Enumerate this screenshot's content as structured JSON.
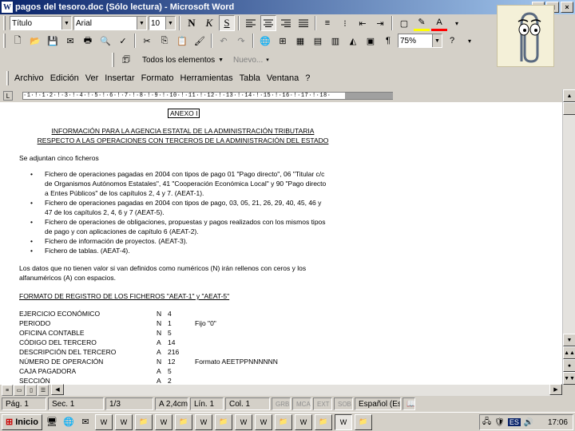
{
  "window": {
    "title": "pagos del tesoro.doc (Sólo lectura) - Microsoft Word",
    "app_icon": "word-doc-icon"
  },
  "format_toolbar": {
    "style": "Título",
    "font": "Arial",
    "size": "10",
    "zoom": "75%"
  },
  "reviewing_toolbar": {
    "show": "Todos los elementos",
    "new_comment": "Nuevo..."
  },
  "menu": {
    "items": [
      "Archivo",
      "Edición",
      "Ver",
      "Insertar",
      "Formato",
      "Herramientas",
      "Tabla",
      "Ventana",
      "?"
    ]
  },
  "ruler": {
    "text": "·1·!·1·2·!·3·!·4·!·5·!·6·!·7·!·8·!·9·!·10·!·11·!·12·!·13·!·14·!·15·!·16·!·17·!·18·"
  },
  "document": {
    "anexo": "ANEXO I",
    "heading1": "INFORMACIÓN PARA LA AGENCIA ESTATAL DE LA ADMINISTRACIÓN TRIBUTARIA",
    "heading2": "RESPECTO A LAS OPERACIONES CON TERCEROS DE LA ADMINISTRACIÓN DEL ESTADO",
    "intro": "Se adjuntan cinco ficheros",
    "bullets": [
      [
        "Fichero de operaciones pagadas en 2004 con tipos de pago 01 \"Pago directo\", 06 \"Titular c/c",
        "de Organismos Autónomos Estatales\", 41 \"Cooperación Económica Local\" y 90 \"Pago directo",
        "a Entes Públicos\" de los capítulos 2, 4 y 7. (AEAT-1)."
      ],
      [
        "Fichero de operaciones pagadas en 2004 con tipos de pago, 03, 05, 21, 26, 29, 40, 45, 46 y",
        "47 de los capítulos 2, 4, 6 y 7 (AEAT-5)."
      ],
      [
        "Fichero de operaciones de obligaciones, propuestas y pagos realizados con los mismos tipos",
        "de pago y con aplicaciones de capítulo 6 (AEAT-2)."
      ],
      [
        "Fichero de información de proyectos. (AEAT-3)."
      ],
      [
        "Fichero de tablas. (AEAT-4)."
      ]
    ],
    "para2": [
      "Los datos que no tienen valor si van definidos como numéricos (N) irán rellenos con ceros y los",
      "alfanuméricos (A) con espacios."
    ],
    "format_title": "FORMATO DE REGISTRO DE LOS FICHEROS \"AEAT-1\" y \"AEAT-5\"",
    "fields": [
      [
        "EJERCICIO ECONÓMICO",
        "N",
        "4",
        ""
      ],
      [
        "PERIODO",
        "N",
        "1",
        "Fijo \"0\""
      ],
      [
        "OFICINA CONTABLE",
        "N",
        "5",
        ""
      ],
      [
        "CÓDIGO DEL TERCERO",
        "A",
        "14",
        ""
      ],
      [
        "DESCRIPCIÓN DEL TERCERO",
        "A",
        "216",
        ""
      ],
      [
        "NÚMERO DE OPERACIÓN",
        "N",
        "12",
        "Formato AEETPPNNNNNN"
      ],
      [
        "CAJA PAGADORA",
        "A",
        "5",
        ""
      ],
      [
        "SECCIÓN",
        "A",
        "2",
        ""
      ]
    ]
  },
  "status": {
    "page": "Pág. 1",
    "section": "Sec. 1",
    "pages": "1/3",
    "position": "A 2,4cm",
    "line": "Lín. 1",
    "column": "Col. 1",
    "rec": "GRB",
    "trk": "MCA",
    "ext": "EXT",
    "ovr": "SOB",
    "language": "Español (Es"
  },
  "taskbar": {
    "start": "Inicio",
    "clock": "17:06",
    "lang": "ES"
  },
  "colors": {
    "title_gradient_start": "#0a246a",
    "title_gradient_end": "#a6caf0",
    "highlight": "#ffff00",
    "font_color": "#ff0000"
  }
}
